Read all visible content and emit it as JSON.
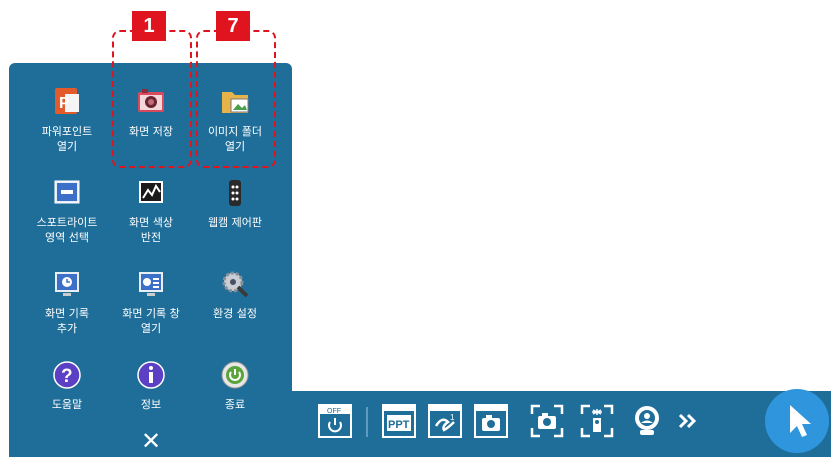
{
  "colors": {
    "panel": "#1f6e99",
    "callout": "#e0141e",
    "cursor_button": "#2f95dd"
  },
  "callouts": [
    {
      "number": "1"
    },
    {
      "number": "7"
    }
  ],
  "menu": {
    "items": [
      {
        "label": "파워포인트\n열기",
        "icon": "powerpoint-icon"
      },
      {
        "label": "화면 저장",
        "icon": "camera-save-icon"
      },
      {
        "label": "이미지 폴더\n열기",
        "icon": "image-folder-icon"
      },
      {
        "label": "스포트라이트\n영역 선택",
        "icon": "spotlight-icon"
      },
      {
        "label": "화면 색상\n반전",
        "icon": "invert-color-icon"
      },
      {
        "label": "웹캠 제어판",
        "icon": "webcam-remote-icon"
      },
      {
        "label": "화면 기록\n추가",
        "icon": "record-add-icon"
      },
      {
        "label": "화면 기록 창\n열기",
        "icon": "record-window-icon"
      },
      {
        "label": "환경 설정",
        "icon": "settings-icon"
      },
      {
        "label": "도움말",
        "icon": "help-icon"
      },
      {
        "label": "정보",
        "icon": "info-icon"
      },
      {
        "label": "종료",
        "icon": "power-icon"
      }
    ],
    "close_icon": "close-icon"
  },
  "taskbar": {
    "power_off_label": "OFF",
    "ppt_label": "PPT",
    "icons": [
      "power-off-icon",
      "ppt-icon",
      "pen-window-icon",
      "camera-window-icon",
      "screen-capture-icon",
      "spotlight-capture-icon",
      "webcam-icon",
      "expand-arrows-icon",
      "cursor-icon"
    ]
  }
}
